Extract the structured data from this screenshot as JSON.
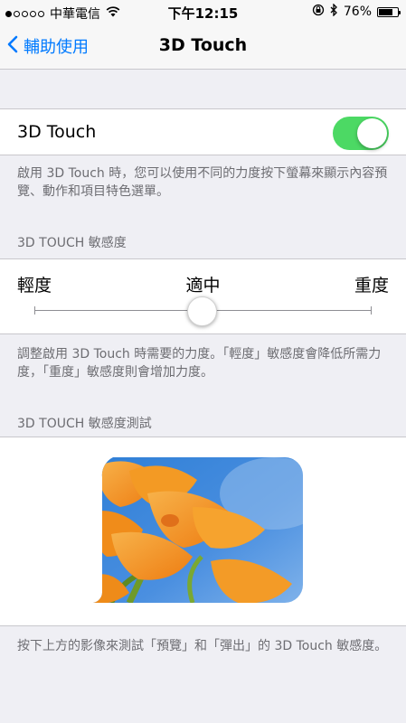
{
  "status_bar": {
    "carrier": "中華電信",
    "time": "下午12:15",
    "battery_percent": "76%",
    "battery_level": 0.76
  },
  "nav": {
    "back_label": "輔助使用",
    "title": "3D Touch"
  },
  "touch_cell": {
    "label": "3D Touch",
    "enabled": true,
    "accent_color": "#4cd964"
  },
  "touch_footer": "啟用 3D Touch 時，您可以使用不同的力度按下螢幕來顯示內容預覽、動作和項目特色選單。",
  "sensitivity": {
    "header": "3D TOUCH 敏感度",
    "labels": [
      "輕度",
      "適中",
      "重度"
    ],
    "selected_index": 1,
    "footer": "調整啟用 3D Touch 時需要的力度。「輕度」敏感度會降低所需力度，「重度」敏感度則會增加力度。"
  },
  "test": {
    "header": "3D TOUCH 敏感度測試",
    "footer": "按下上方的影像來測試「預覽」和「彈出」的 3D Touch 敏感度。"
  },
  "colors": {
    "tint": "#007aff",
    "background": "#efeff4"
  }
}
